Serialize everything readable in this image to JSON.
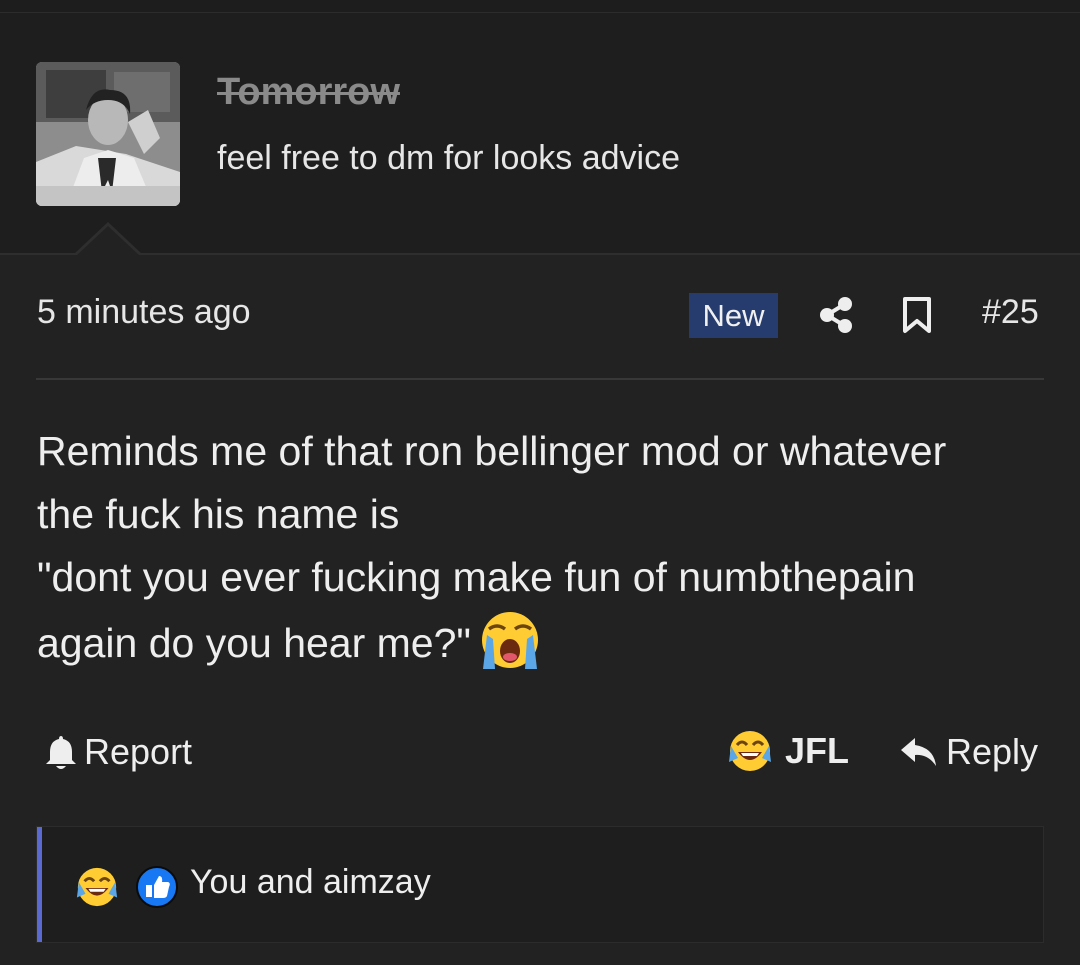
{
  "post": {
    "username": "Tomorrow",
    "user_title": "feel free to dm for looks advice",
    "timestamp": "5 minutes ago",
    "new_badge": "New",
    "post_number": "#25",
    "body_lines": [
      "Reminds me of that ron bellinger mod or whatever",
      "the fuck his name is",
      "\"dont you ever fucking make fun of numbthepain",
      "again do you hear me?\""
    ],
    "body_emoji": "crying-laughing-emoji"
  },
  "actions": {
    "report_label": "Report",
    "jfl_label": "JFL",
    "reply_label": "Reply"
  },
  "reactions": {
    "text": "You and aimzay",
    "icons": [
      "laughing-crying-emoji",
      "thumbs-up-icon"
    ]
  },
  "colors": {
    "background": "#222222",
    "header_background": "#1e1e1e",
    "new_badge": "#263b6e",
    "reaction_bar": "#5a6ad0",
    "thumbs_up": "#1877f2"
  }
}
